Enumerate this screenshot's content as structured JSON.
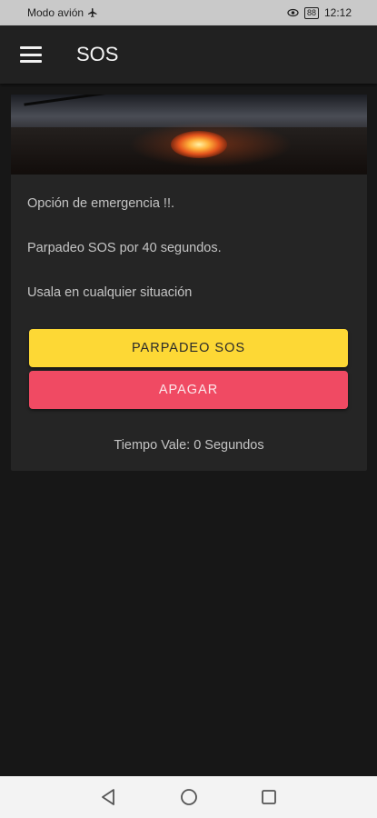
{
  "status_bar": {
    "mode": "Modo avión",
    "battery": "88",
    "time": "12:12"
  },
  "app_bar": {
    "title": "SOS",
    "menu_icon": "hamburger-menu-icon"
  },
  "card": {
    "line1": "Opción de emergencia !!.",
    "line2": "Parpadeo SOS por 40 segundos.",
    "line3": "Usala en cualquier situación",
    "sos_button": "PARPADEO SOS",
    "off_button": "APAGAR",
    "timer_text": "Tiempo Vale: 0 Segundos"
  },
  "colors": {
    "sos_button": "#fdd835",
    "off_button": "#f04a63",
    "background": "#171717"
  },
  "nav_bar": {
    "back_icon": "back-triangle-icon",
    "home_icon": "home-circle-icon",
    "recents_icon": "recents-square-icon"
  }
}
